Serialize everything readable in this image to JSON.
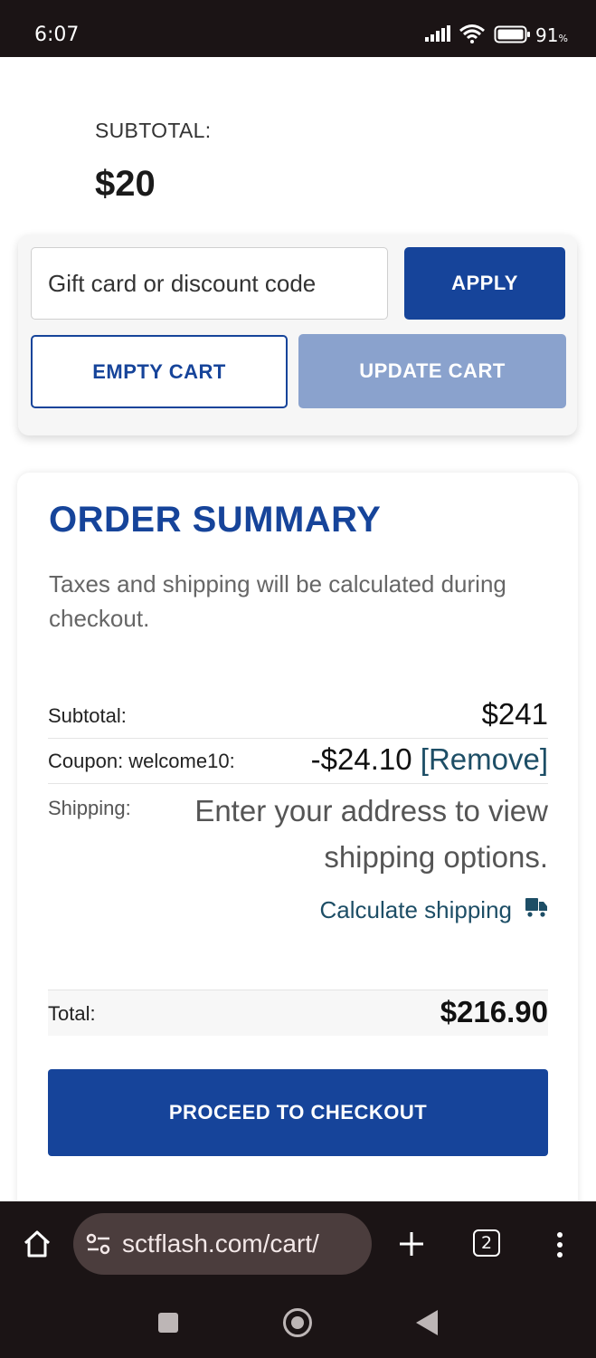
{
  "status_bar": {
    "time": "6:07",
    "battery": "91",
    "battery_unit": "%"
  },
  "cart": {
    "subtotal_label": "SUBTOTAL:",
    "subtotal_value": "$20",
    "code_placeholder": "Gift card or discount code",
    "apply_label": "APPLY",
    "empty_label": "EMPTY CART",
    "update_label": "UPDATE CART"
  },
  "summary": {
    "title": "ORDER SUMMARY",
    "note": "Taxes and shipping will be calculated during checkout.",
    "subtotal_label": "Subtotal:",
    "subtotal_value": "$241",
    "coupon_label": "Coupon: welcome10:",
    "coupon_value": "-$24.10",
    "coupon_remove": "[Remove]",
    "shipping_label": "Shipping:",
    "shipping_message": "Enter your address to view shipping options.",
    "calculate_label": "Calculate shipping",
    "total_label": "Total:",
    "total_value": "$216.90",
    "checkout_label": "PROCEED TO CHECKOUT"
  },
  "browser": {
    "url": "sctflash.com/cart/",
    "tab_count": "2"
  },
  "icons": [
    "signal-icon",
    "wifi-icon",
    "battery-icon",
    "truck-icon",
    "home-icon",
    "site-settings-icon",
    "new-tab-icon",
    "tabs-icon",
    "menu-icon",
    "recents-icon",
    "home-nav-icon",
    "back-icon"
  ]
}
